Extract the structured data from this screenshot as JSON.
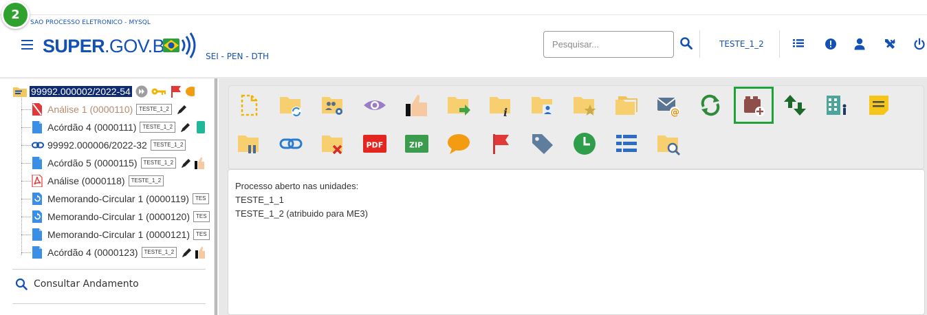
{
  "step_badge": "2",
  "header": {
    "org_title": "SAO PROCESSO ELETRONICO - MYSQL",
    "logo_bold": "SUPER",
    "logo_rest": ".GOV.BR",
    "logo_sub": "SEI - PEN - DTH",
    "search_placeholder": "Pesquisar...",
    "unit": "TESTE_1_2",
    "icons": [
      "search-icon",
      "list-icon",
      "alert-icon",
      "user-icon",
      "tools-icon",
      "power-icon"
    ],
    "accent": "#1351b4"
  },
  "tree": {
    "process": "99992.000002/2022-54",
    "items": [
      {
        "label": "Análise 1 (0000110)",
        "tag": "TESTE_1_2",
        "icon": "cancelled-doc-icon",
        "muted": true
      },
      {
        "label": "Acórdão 4 (0000111)",
        "tag": "TESTE_1_2",
        "icon": "doc-icon"
      },
      {
        "label": "99992.000006/2022-32",
        "tag": "TESTE_1_2",
        "icon": "link-icon"
      },
      {
        "label": "Acórdão 5 (0000115)",
        "tag": "TESTE_1_2",
        "icon": "doc-icon"
      },
      {
        "label": "Análise (0000118)",
        "tag": "TESTE_1_2",
        "icon": "pdf-doc-icon"
      },
      {
        "label": "Memorando-Circular 1 (0000119)",
        "tag": "TES",
        "icon": "circular-doc-icon"
      },
      {
        "label": "Memorando-Circular 1 (0000120)",
        "tag": "TES",
        "icon": "circular-doc-icon"
      },
      {
        "label": "Memorando-Circular 1 (0000121)",
        "tag": "TES",
        "icon": "doc-icon"
      },
      {
        "label": "Acórdão 4 (0000123)",
        "tag": "TESTE_1_2",
        "icon": "doc-icon"
      }
    ],
    "consult_link": "Consultar Andamento"
  },
  "toolbar_icons_row1": [
    "new-document-icon",
    "reopen-process-icon",
    "assign-process-icon",
    "view-icon",
    "sign-icon",
    "send-process-icon",
    "process-info-icon",
    "assign-user-icon",
    "favorite-process-icon",
    "process-relations-icon",
    "send-email-icon",
    "refresh-icon",
    "add-block-icon",
    "sort-icon",
    "units-icon",
    "note-icon"
  ],
  "toolbar_icons_row2": [
    "suspend-process-icon",
    "link-process-icon",
    "remove-process-icon",
    "generate-pdf-icon",
    "generate-zip-icon",
    "comment-icon",
    "flag-icon",
    "tag-icon",
    "deadline-icon",
    "list-view-icon",
    "search-process-icon"
  ],
  "content": {
    "line1": "Processo aberto nas unidades:",
    "line2": "TESTE_1_1",
    "line3": "TESTE_1_2 (atribuido para ME3)"
  }
}
